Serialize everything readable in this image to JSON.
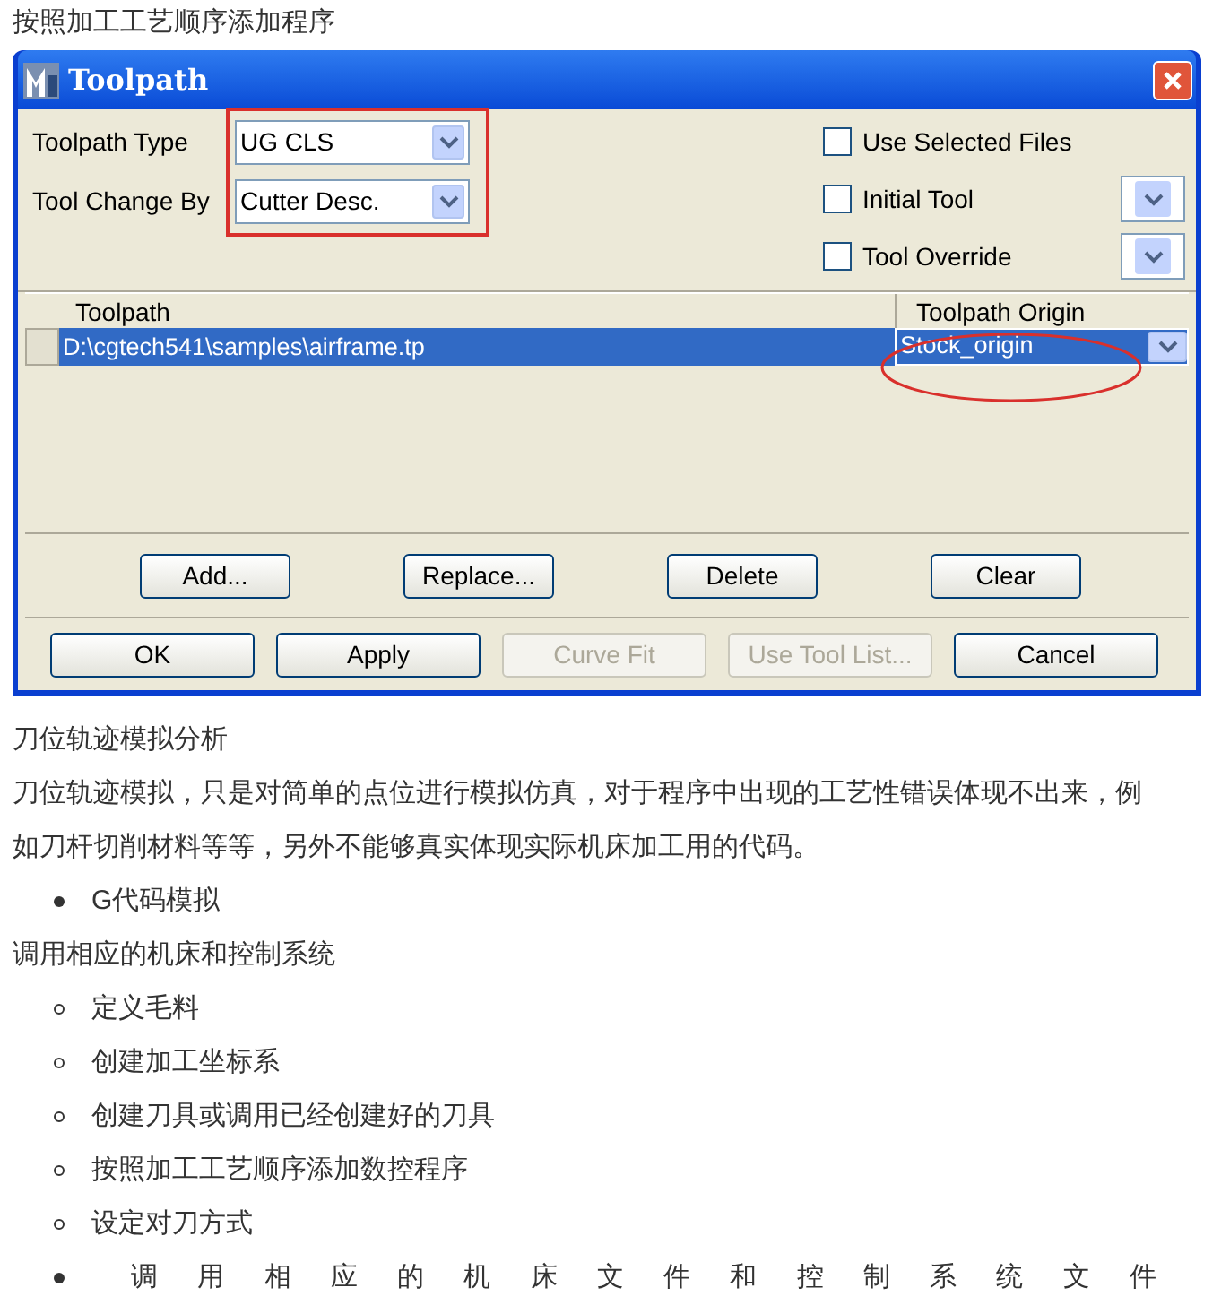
{
  "caption": "按照加工工艺顺序添加程序",
  "dialog": {
    "title": "Toolpath",
    "fields": [
      {
        "label": "Toolpath Type",
        "value": "UG CLS"
      },
      {
        "label": "Tool Change By",
        "value": "Cutter Desc."
      }
    ],
    "options": [
      {
        "label": "Use Selected Files",
        "checked": false,
        "kind": "plain"
      },
      {
        "label": "Initial Tool",
        "checked": false,
        "kind": "dropdown"
      },
      {
        "label": "Tool Override",
        "checked": false,
        "kind": "dropdown"
      }
    ],
    "table": {
      "columns": [
        "Toolpath",
        "Toolpath Origin"
      ],
      "rows": [
        {
          "toolpath": "D:\\cgtech541\\samples\\airframe.tp",
          "origin": "Stock_origin",
          "selected": true
        }
      ]
    },
    "list_buttons": [
      "Add...",
      "Replace...",
      "Delete",
      "Clear"
    ],
    "buttons": [
      {
        "label": "OK",
        "disabled": false
      },
      {
        "label": "Apply",
        "disabled": false
      },
      {
        "label": "Curve Fit",
        "disabled": true
      },
      {
        "label": "Use Tool List...",
        "disabled": true
      },
      {
        "label": "Cancel",
        "disabled": false
      }
    ]
  },
  "article": [
    {
      "kind": "text",
      "text": "刀位轨迹模拟分析"
    },
    {
      "kind": "text",
      "text": "刀位轨迹模拟，只是对简单的点位进行模拟仿真，对于程序中出现的工艺性错误体现不出来，例如刀杆切削材料等等，另外不能够真实体现实际机床加工用的代码。"
    },
    {
      "kind": "bullet",
      "text": "G代码模拟"
    },
    {
      "kind": "text",
      "text": "调用相应的机床和控制系统"
    },
    {
      "kind": "sub_bullet",
      "text": "定义毛料"
    },
    {
      "kind": "sub_bullet",
      "text": "创建加工坐标系"
    },
    {
      "kind": "sub_bullet",
      "text": "创建刀具或调用已经创建好的刀具"
    },
    {
      "kind": "sub_bullet",
      "text": "按照加工工艺顺序添加数控程序"
    },
    {
      "kind": "sub_bullet",
      "text": "设定对刀方式"
    },
    {
      "kind": "bullet",
      "text": "调用相应的机床文件和控制系统文件",
      "justified": true
    }
  ]
}
